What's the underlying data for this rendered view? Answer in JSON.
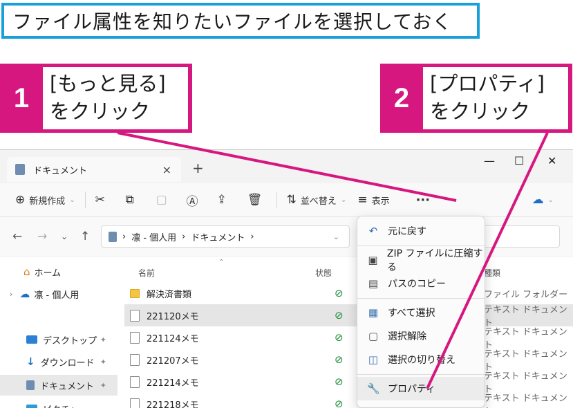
{
  "heading": "ファイル属性を知りたいファイルを選択しておく",
  "callouts": [
    {
      "number": "1",
      "line1": "[もっと見る]",
      "line2": "をクリック"
    },
    {
      "number": "2",
      "line1": "[プロパティ]",
      "line2": "をクリック"
    }
  ],
  "colors": {
    "accent": "#d6177f",
    "heading_border": "#1aa0d8"
  },
  "window": {
    "tab_title": "ドキュメント",
    "tab_close": "×",
    "new_tab": "+",
    "minimize": "—",
    "maximize": "☐",
    "close": "✕"
  },
  "toolbar": {
    "new_label": "新規作成",
    "sort_label": "並べ替え",
    "view_label": "表示",
    "more": "···"
  },
  "address": {
    "path": [
      "凛 - 個人用",
      "ドキュメント"
    ],
    "sep": "›"
  },
  "sidebar": [
    {
      "label": "ホーム",
      "icon": "home-icon"
    },
    {
      "label": "凛 - 個人用",
      "icon": "cloud-icon"
    },
    {
      "label": "デスクトップ",
      "icon": "desktop-icon"
    },
    {
      "label": "ダウンロード",
      "icon": "download-icon"
    },
    {
      "label": "ドキュメント",
      "icon": "document-icon"
    },
    {
      "label": "ピクチャ",
      "icon": "pictures-icon"
    }
  ],
  "columns": {
    "name": "名前",
    "status": "状態",
    "type": "種類"
  },
  "files": [
    {
      "name": "解決済書類",
      "type": "ファイル フォルダー"
    },
    {
      "name": "221120メモ",
      "type": "テキスト ドキュメント"
    },
    {
      "name": "221124メモ",
      "type": "テキスト ドキュメント"
    },
    {
      "name": "221207メモ",
      "type": "テキスト ドキュメント"
    },
    {
      "name": "221214メモ",
      "type": "テキスト ドキュメント"
    },
    {
      "name": "221218メモ",
      "type": "テキスト ドキュメント"
    }
  ],
  "menu": [
    {
      "label": "元に戻す",
      "icon": "undo-icon"
    },
    {
      "label": "ZIP ファイルに圧縮する",
      "icon": "zip-icon"
    },
    {
      "label": "パスのコピー",
      "icon": "copy-path-icon"
    },
    {
      "label": "すべて選択",
      "icon": "select-all-icon"
    },
    {
      "label": "選択解除",
      "icon": "select-none-icon"
    },
    {
      "label": "選択の切り替え",
      "icon": "invert-selection-icon"
    },
    {
      "label": "プロパティ",
      "icon": "wrench-icon"
    }
  ]
}
